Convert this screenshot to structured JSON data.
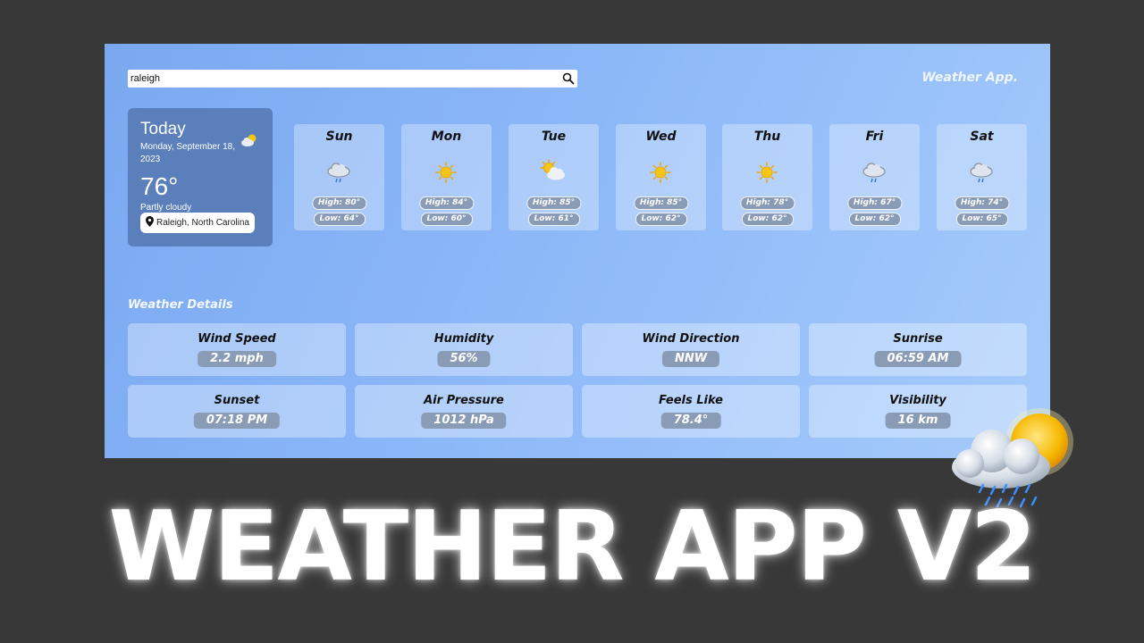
{
  "search": {
    "value": "raleigh",
    "placeholder": ""
  },
  "brand": "Weather App.",
  "today": {
    "title": "Today",
    "date": "Monday, September 18, 2023",
    "temp": "76°",
    "condition": "Partly cloudy",
    "icon": "partly-cloudy-icon",
    "location": "Raleigh, North Carolina"
  },
  "forecast": [
    {
      "day": "Sun",
      "icon": "rain-icon",
      "high": "High: 80°",
      "low": "Low: 64°"
    },
    {
      "day": "Mon",
      "icon": "sun-icon",
      "high": "High: 84°",
      "low": "Low: 60°"
    },
    {
      "day": "Tue",
      "icon": "partly-cloudy-icon",
      "high": "High: 85°",
      "low": "Low: 61°"
    },
    {
      "day": "Wed",
      "icon": "sun-icon",
      "high": "High: 85°",
      "low": "Low: 62°"
    },
    {
      "day": "Thu",
      "icon": "sun-icon",
      "high": "High: 78°",
      "low": "Low: 62°"
    },
    {
      "day": "Fri",
      "icon": "rain-icon",
      "high": "High: 67°",
      "low": "Low: 62°"
    },
    {
      "day": "Sat",
      "icon": "rain-icon",
      "high": "High: 74°",
      "low": "Low: 65°"
    }
  ],
  "details_title": "Weather Details",
  "details": [
    {
      "label": "Wind Speed",
      "value": "2.2 mph"
    },
    {
      "label": "Humidity",
      "value": "56%"
    },
    {
      "label": "Wind Direction",
      "value": "NNW"
    },
    {
      "label": "Sunrise",
      "value": "06:59 AM"
    },
    {
      "label": "Sunset",
      "value": "07:18 PM"
    },
    {
      "label": "Air Pressure",
      "value": "1012 hPa"
    },
    {
      "label": "Feels Like",
      "value": "78.4°"
    },
    {
      "label": "Visibility",
      "value": "16 km"
    }
  ],
  "headline": "WEATHER APP V2",
  "colors": {
    "background": "#383838",
    "app_gradient_start": "#7aa8f0",
    "app_gradient_end": "#a6cbfb",
    "today_card": "#5a7fba",
    "pill": "#8a9bb5",
    "sun": "#f5c518"
  }
}
